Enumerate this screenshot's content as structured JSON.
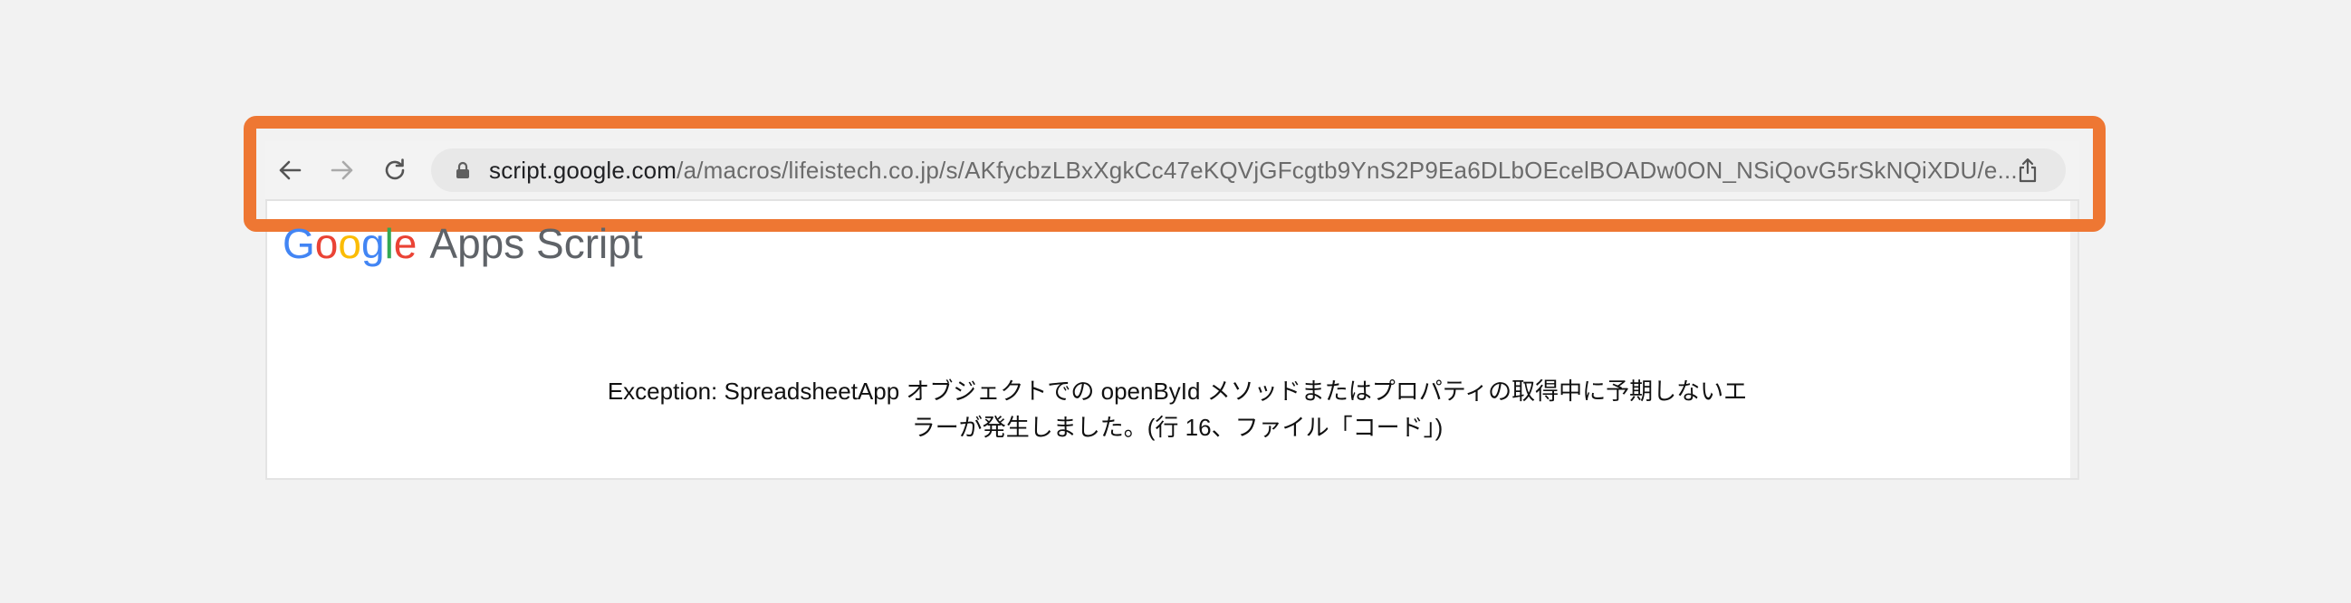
{
  "browser": {
    "url_host": "script.google.com",
    "url_path": "/a/macros/lifeistech.co.jp/s/AKfycbzLBxXgkCc47eKQVjGFcgtb9YnS2P9Ea6DLbOEcelBOADw0ON_NSiQovG5rSkNQiXDU/e...",
    "icons": {
      "back": "back-arrow-icon",
      "forward": "forward-arrow-icon",
      "reload": "reload-icon",
      "lock": "lock-icon",
      "share": "share-icon"
    }
  },
  "logo": {
    "letters": [
      "G",
      "o",
      "o",
      "g",
      "l",
      "e"
    ],
    "product": "Apps Script"
  },
  "message": {
    "line1": "Exception: SpreadsheetApp オブジェクトでの openById メソッドまたはプロパティの取得中に予期しないエ",
    "line2": "ラーが発生しました。(行 16、ファイル「コード」)"
  },
  "colors": {
    "highlight": "#ee7733",
    "google_blue": "#4285f4",
    "google_red": "#ea4335",
    "google_yellow": "#fbbc05",
    "google_green": "#34a853"
  }
}
